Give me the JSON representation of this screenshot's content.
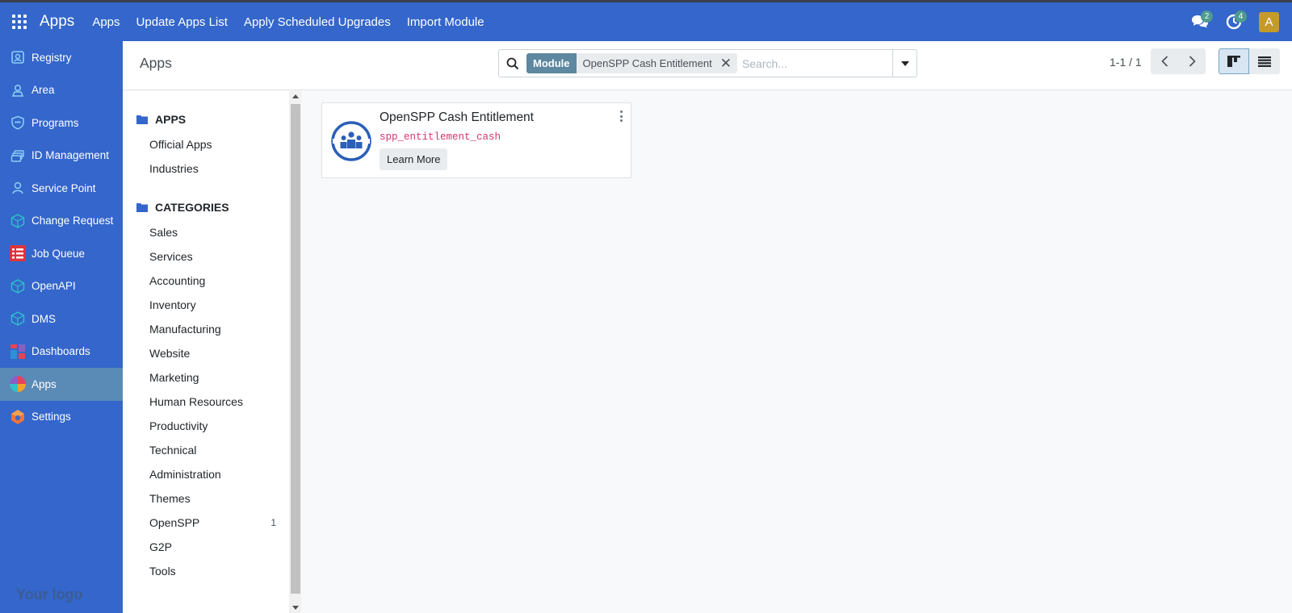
{
  "navbar": {
    "brand": "Apps",
    "links": [
      "Apps",
      "Update Apps List",
      "Apply Scheduled Upgrades",
      "Import Module"
    ],
    "messages_count": "2",
    "activities_count": "4",
    "avatar_letter": "A"
  },
  "sidebar": {
    "items": [
      {
        "label": "Registry",
        "icon": "registry-icon"
      },
      {
        "label": "Area",
        "icon": "area-icon"
      },
      {
        "label": "Programs",
        "icon": "programs-icon"
      },
      {
        "label": "ID Management",
        "icon": "id-management-icon"
      },
      {
        "label": "Service Point",
        "icon": "service-point-icon"
      },
      {
        "label": "Change Request",
        "icon": "change-request-icon"
      },
      {
        "label": "Job Queue",
        "icon": "job-queue-icon"
      },
      {
        "label": "OpenAPI",
        "icon": "openapi-icon"
      },
      {
        "label": "DMS",
        "icon": "dms-icon"
      },
      {
        "label": "Dashboards",
        "icon": "dashboards-icon"
      },
      {
        "label": "Apps",
        "icon": "apps-icon"
      },
      {
        "label": "Settings",
        "icon": "settings-icon"
      }
    ],
    "active": "Apps",
    "logo_text": "Your logo"
  },
  "control_panel": {
    "title": "Apps",
    "facet_label": "Module",
    "facet_value": "OpenSPP Cash Entitlement",
    "search_placeholder": "Search...",
    "pager": "1-1 / 1"
  },
  "search_panel": {
    "apps_header": "APPS",
    "apps_items": [
      "Official Apps",
      "Industries"
    ],
    "categories_header": "CATEGORIES",
    "categories": [
      {
        "label": "Sales",
        "count": ""
      },
      {
        "label": "Services",
        "count": ""
      },
      {
        "label": "Accounting",
        "count": ""
      },
      {
        "label": "Inventory",
        "count": ""
      },
      {
        "label": "Manufacturing",
        "count": ""
      },
      {
        "label": "Website",
        "count": ""
      },
      {
        "label": "Marketing",
        "count": ""
      },
      {
        "label": "Human Resources",
        "count": ""
      },
      {
        "label": "Productivity",
        "count": ""
      },
      {
        "label": "Technical",
        "count": ""
      },
      {
        "label": "Administration",
        "count": ""
      },
      {
        "label": "Themes",
        "count": ""
      },
      {
        "label": "OpenSPP",
        "count": "1"
      },
      {
        "label": "G2P",
        "count": ""
      },
      {
        "label": "Tools",
        "count": ""
      }
    ]
  },
  "card": {
    "title": "OpenSPP Cash Entitlement",
    "technical_name": "spp_entitlement_cash",
    "button": "Learn More"
  },
  "colors": {
    "navbar": "#3466cb",
    "sidebar_active": "#5a8ab6",
    "facet_label": "#5e87a0",
    "technical_name": "#d6336c",
    "avatar": "#c69a2a"
  }
}
